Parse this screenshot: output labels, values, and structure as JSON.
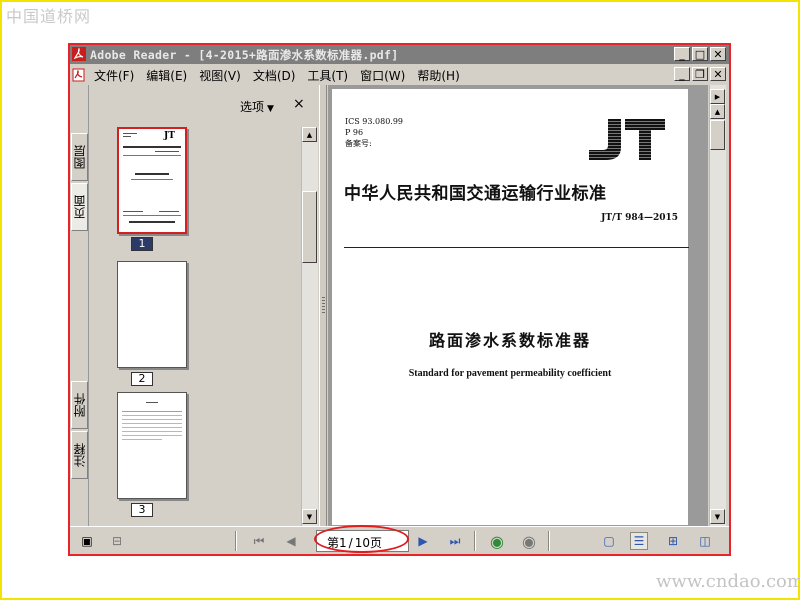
{
  "watermark": {
    "top_left": "中国道桥网",
    "bottom_right": "www.cndao.com"
  },
  "window": {
    "app_name": "Adobe Reader",
    "title": "Adobe Reader - [4-2015+路面渗水系数标准器.pdf]"
  },
  "menu": {
    "items": [
      "文件(F)",
      "编辑(E)",
      "视图(V)",
      "文档(D)",
      "工具(T)",
      "窗口(W)",
      "帮助(H)"
    ]
  },
  "side_tabs": [
    "图层",
    "页面",
    "附件",
    "注释"
  ],
  "nav_panel": {
    "options_label": "选项",
    "close_label": "×",
    "thumbnails": [
      {
        "page": "1",
        "selected": true
      },
      {
        "page": "2",
        "selected": false
      },
      {
        "page": "3",
        "selected": false
      }
    ]
  },
  "document": {
    "ics": "ICS 93.080.99",
    "p_code": "P 96",
    "filing_label": "备案号:",
    "logo_text": "JT",
    "heading": "中华人民共和国交通运输行业标准",
    "standard_code": "JT/T 984—2015",
    "title_cn": "路面渗水系数标准器",
    "title_en": "Standard for pavement permeability coefficient"
  },
  "statusbar": {
    "page_label_prefix": "第",
    "current_page": "1",
    "total_pages": "10",
    "page_label_suffix": "页"
  },
  "colors": {
    "window_border": "#e8242b",
    "titlebar": "#7e7e7e",
    "highlight_oval": "#e21c1c",
    "outer_border": "#f3e400"
  }
}
